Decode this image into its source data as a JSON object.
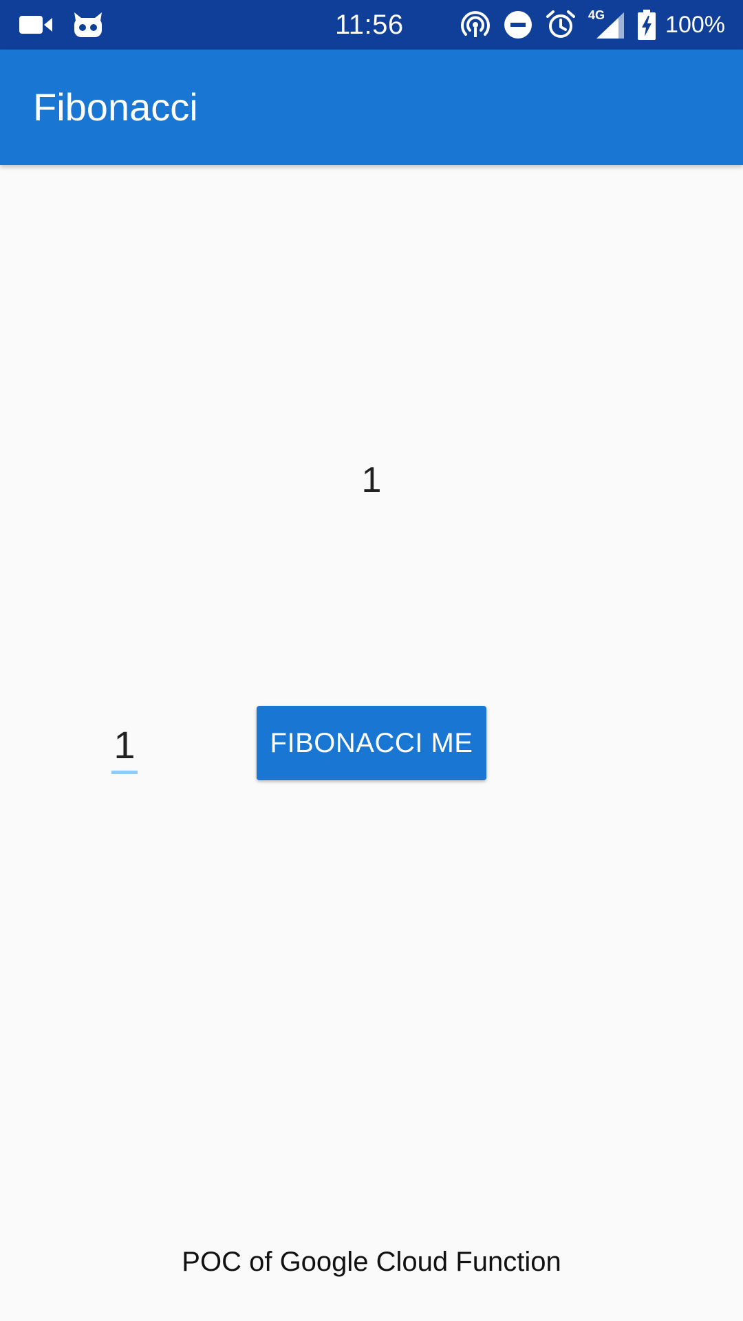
{
  "status_bar": {
    "time": "11:56",
    "battery_percent": "100%",
    "network_label": "4G",
    "background_color": "#0f3f99",
    "left_icons": [
      "video-camera-icon",
      "cyanogen-mascot-icon"
    ],
    "right_icons": [
      "hotspot-icon",
      "do-not-disturb-icon",
      "alarm-icon",
      "signal-4g-icon",
      "battery-charging-icon"
    ]
  },
  "app_bar": {
    "title": "Fibonacci",
    "color": "#1976d2"
  },
  "main": {
    "result": "1",
    "input_value": "1",
    "button_label": "FIBONACCI ME",
    "accent_color": "#1976d2",
    "underline_color": "#90caf9"
  },
  "footer": {
    "text": "POC of Google Cloud Function"
  }
}
